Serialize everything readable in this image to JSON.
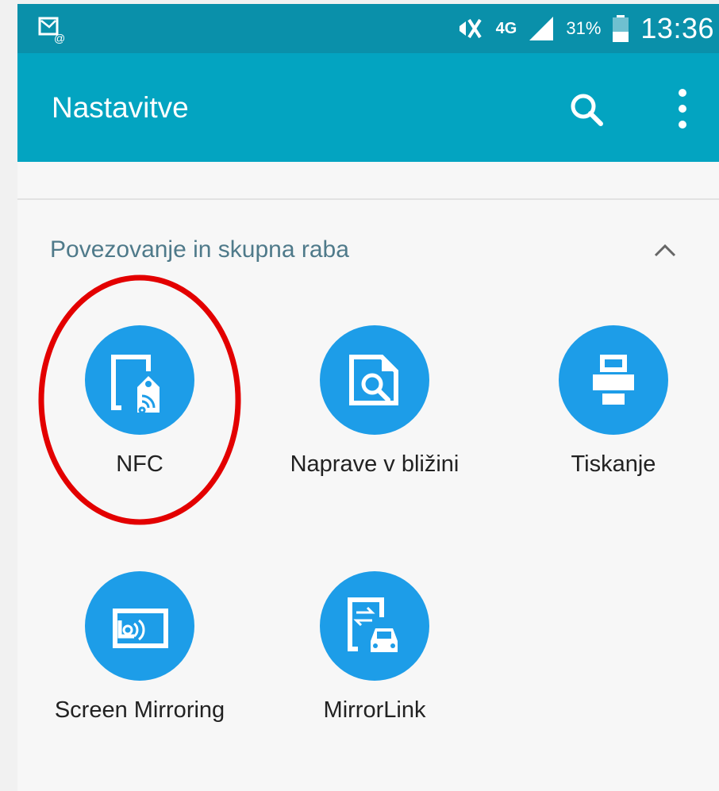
{
  "status_bar": {
    "left_icon": "email-notification-icon",
    "network": "4G",
    "battery": "31%",
    "time": "13:36"
  },
  "app_bar": {
    "title": "Nastavitve",
    "search_icon": "search-icon",
    "more_icon": "more-vertical-icon"
  },
  "section": {
    "title": "Povezovanje in skupna raba",
    "collapse_icon": "chevron-up-icon"
  },
  "tiles": [
    {
      "label": "NFC",
      "icon": "nfc-tag-icon"
    },
    {
      "label": "Naprave v bližini",
      "icon": "device-search-icon"
    },
    {
      "label": "Tiskanje",
      "icon": "printer-icon"
    },
    {
      "label": "Screen Mirroring",
      "icon": "screen-mirroring-icon"
    },
    {
      "label": "MirrorLink",
      "icon": "mirrorlink-car-icon"
    }
  ],
  "colors": {
    "status_bar": "#0a90aa",
    "app_bar": "#03a4c1",
    "tile_circle": "#1d9de8",
    "highlight_ring": "#e30000"
  }
}
